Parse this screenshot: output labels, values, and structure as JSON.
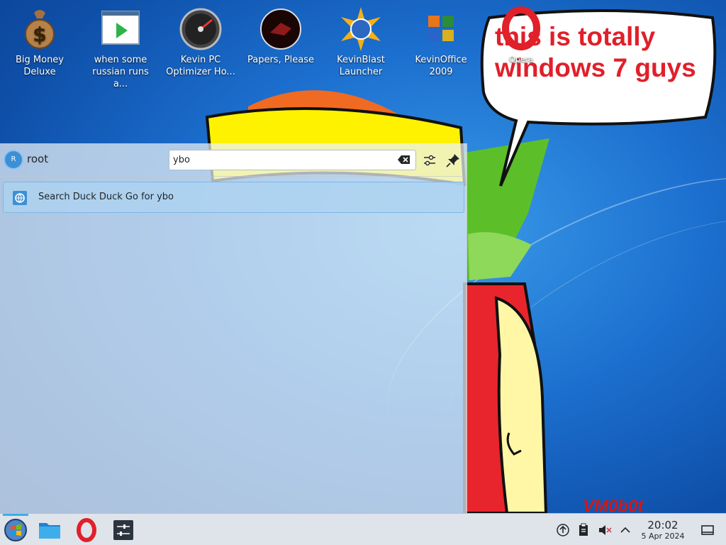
{
  "desktop": {
    "icons": [
      {
        "label": "Big Money Deluxe",
        "icon": "money-bag-icon"
      },
      {
        "label": "when some russian runs a...",
        "icon": "video-play-icon"
      },
      {
        "label": "Kevin PC Optimizer Ho...",
        "icon": "speedometer-icon"
      },
      {
        "label": "Papers, Please",
        "icon": "papers-please-icon"
      },
      {
        "label": "KevinBlast Launcher",
        "icon": "globe-burst-icon"
      },
      {
        "label": "KevinOffice 2009",
        "icon": "office-logo-icon"
      },
      {
        "label": "Opera",
        "icon": "opera-icon"
      }
    ],
    "bubble_text": "this is totally windows 7 guys",
    "watermark": "VM0b0t"
  },
  "launcher": {
    "user": {
      "initial": "R",
      "name": "root"
    },
    "search": {
      "value": "ybo"
    },
    "results": [
      {
        "label": "Search Duck Duck Go for ybo",
        "icon": "web-search-icon"
      }
    ]
  },
  "taskbar": {
    "apps": [
      {
        "name": "application-launcher",
        "icon": "start-orb-icon"
      },
      {
        "name": "file-manager",
        "icon": "folder-icon"
      },
      {
        "name": "opera-browser",
        "icon": "opera-icon"
      },
      {
        "name": "system-settings",
        "icon": "sliders-icon"
      }
    ],
    "tray": [
      "updates-icon",
      "clipboard-icon",
      "volume-muted-icon",
      "chevron-up-icon",
      "show-desktop-icon"
    ],
    "clock": {
      "time": "20:02",
      "date": "5 Apr 2024"
    }
  },
  "colors": {
    "accent": "#3daee9",
    "bubble_text": "#e0202a",
    "panel_bg": "#dfe4ea"
  }
}
